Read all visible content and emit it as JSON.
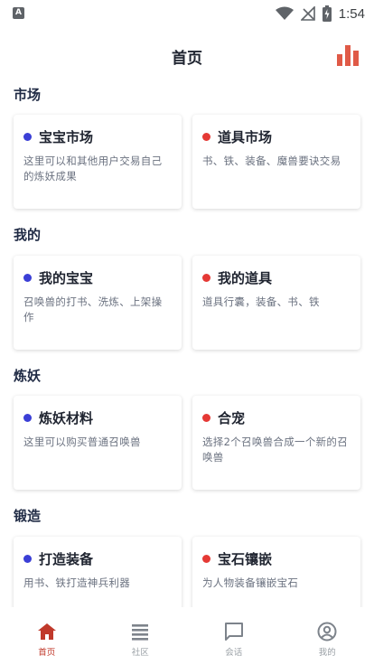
{
  "status_bar": {
    "time": "1:54",
    "left_badge": "A"
  },
  "header": {
    "title": "首页"
  },
  "sections": [
    {
      "title": "市场",
      "cards": [
        {
          "title": "宝宝市场",
          "desc": "这里可以和其他用户交易自己的炼妖成果",
          "dot": "blue"
        },
        {
          "title": "道具市场",
          "desc": "书、铁、装备、魔兽要诀交易",
          "dot": "red"
        }
      ]
    },
    {
      "title": "我的",
      "cards": [
        {
          "title": "我的宝宝",
          "desc": "召唤兽的打书、洗炼、上架操作",
          "dot": "blue"
        },
        {
          "title": "我的道具",
          "desc": "道具行囊，装备、书、铁",
          "dot": "red"
        }
      ]
    },
    {
      "title": "炼妖",
      "cards": [
        {
          "title": "炼妖材料",
          "desc": "这里可以购买普通召唤兽",
          "dot": "blue"
        },
        {
          "title": "合宠",
          "desc": "选择2个召唤兽合成一个新的召唤兽",
          "dot": "red"
        }
      ]
    },
    {
      "title": "锻造",
      "cards": [
        {
          "title": "打造装备",
          "desc": "用书、铁打造神兵利器",
          "dot": "blue"
        },
        {
          "title": "宝石镶嵌",
          "desc": "为人物装备镶嵌宝石",
          "dot": "red"
        }
      ]
    }
  ],
  "tabbar": {
    "items": [
      {
        "label": "首页",
        "icon": "home-icon",
        "active": true
      },
      {
        "label": "社区",
        "icon": "list-icon",
        "active": false
      },
      {
        "label": "会话",
        "icon": "chat-icon",
        "active": false
      },
      {
        "label": "我的",
        "icon": "user-icon",
        "active": false
      }
    ]
  },
  "colors": {
    "accent": "#c0392b",
    "blue_dot": "#3b3fd6",
    "red_dot": "#e53935"
  }
}
